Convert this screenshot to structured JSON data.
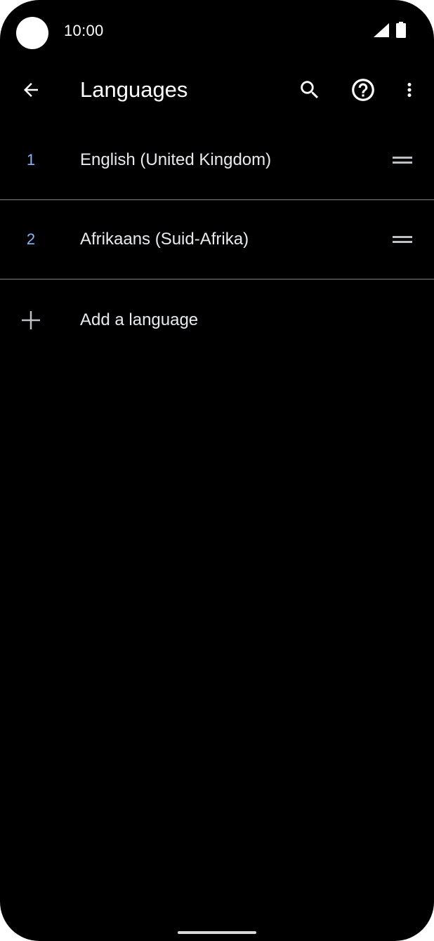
{
  "status_bar": {
    "time": "10:00",
    "signal_icon": "cellular-signal-icon",
    "battery_icon": "battery-full-icon"
  },
  "app_bar": {
    "title": "Languages",
    "back_icon": "arrow-back-icon",
    "search_icon": "search-icon",
    "help_icon": "help-circle-icon",
    "more_icon": "more-vert-icon"
  },
  "languages": [
    {
      "number": "1",
      "name": "English (United Kingdom)"
    },
    {
      "number": "2",
      "name": "Afrikaans (Suid-Afrika)"
    }
  ],
  "add_language": {
    "label": "Add a language",
    "icon": "plus-icon"
  },
  "colors": {
    "background": "#000000",
    "accent": "#8ab4f8",
    "text": "#e8eaed",
    "divider": "#80868b"
  }
}
